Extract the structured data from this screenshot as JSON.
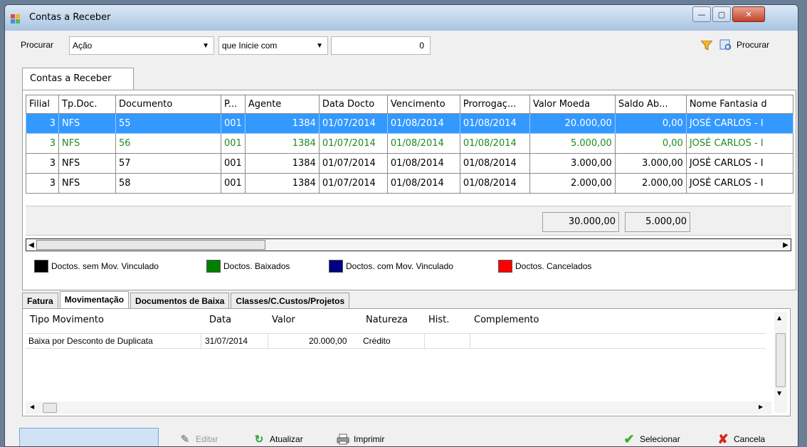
{
  "window": {
    "title": "Contas a Receber",
    "controls": {
      "minimize": "—",
      "maximize": "▢",
      "close": "✕"
    }
  },
  "toolbar": {
    "search_label": "Procurar",
    "field_select": "Ação",
    "mode_select": "que Inicie com",
    "search_value": "0",
    "search_button_label": "Procurar"
  },
  "main_tab": "Contas a Receber",
  "grid": {
    "columns": [
      "Filial",
      "Tp.Doc.",
      "Documento",
      "P...",
      "Agente",
      "Data Docto",
      "Vencimento",
      "Prorrogaç...",
      "Valor Moeda",
      "Saldo Ab...",
      "Nome Fantasia d"
    ],
    "rows": [
      [
        "3",
        "NFS",
        "55",
        "001",
        "1384",
        "01/07/2014",
        "01/08/2014",
        "01/08/2014",
        "20.000,00",
        "0,00",
        "JOSÉ CARLOS - I"
      ],
      [
        "3",
        "NFS",
        "56",
        "001",
        "1384",
        "01/07/2014",
        "01/08/2014",
        "01/08/2014",
        "5.000,00",
        "0,00",
        "JOSÉ CARLOS - I"
      ],
      [
        "3",
        "NFS",
        "57",
        "001",
        "1384",
        "01/07/2014",
        "01/08/2014",
        "01/08/2014",
        "3.000,00",
        "3.000,00",
        "JOSÉ CARLOS - I"
      ],
      [
        "3",
        "NFS",
        "58",
        "001",
        "1384",
        "01/07/2014",
        "01/08/2014",
        "01/08/2014",
        "2.000,00",
        "2.000,00",
        "JOSÉ CARLOS - I"
      ]
    ],
    "total_valor": "30.000,00",
    "total_saldo": "5.000,00"
  },
  "legend": [
    {
      "label": "Doctos. sem Mov. Vinculado",
      "color": "#000000"
    },
    {
      "label": "Doctos. Baixados",
      "color": "#008000"
    },
    {
      "label": "Doctos. com Mov. Vinculado",
      "color": "#000080"
    },
    {
      "label": "Doctos. Cancelados",
      "color": "#ff0000"
    }
  ],
  "lower_tabs": [
    "Fatura",
    "Movimentação",
    "Documentos de Baixa",
    "Classes/C.Custos/Projetos"
  ],
  "movements": {
    "columns": [
      "Tipo Movimento",
      "Data",
      "Valor",
      "Natureza",
      "Hist.",
      "Complemento"
    ],
    "rows": [
      [
        "Baixa por Desconto de Duplicata",
        "31/07/2014",
        "20.000,00",
        "Crédito",
        "",
        ""
      ]
    ]
  },
  "bottom": {
    "edit_label": "Editar",
    "refresh_label": "Atualizar",
    "print_label": "Imprimir",
    "select_label": "Selecionar",
    "cancel_label": "Cancela"
  },
  "colors": {
    "selected_row": "#3399ff",
    "settled_text": "#1e8c1e"
  }
}
